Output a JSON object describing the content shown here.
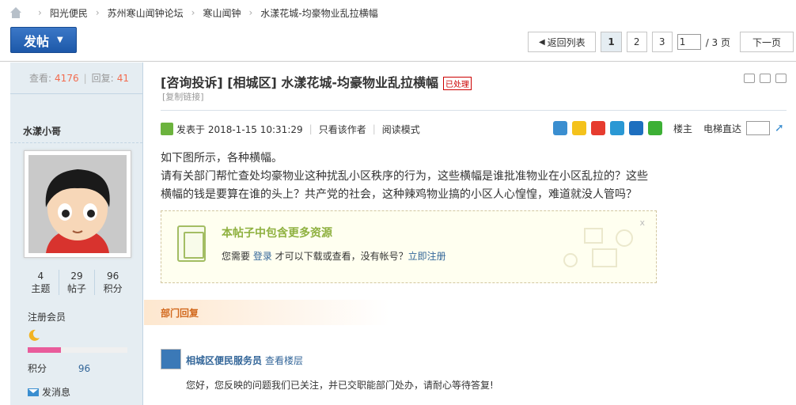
{
  "breadcrumb": {
    "home_icon": "home-icon",
    "items": [
      "阳光便民",
      "苏州寒山闻钟论坛",
      "寒山闻钟",
      "水漾花城-均豪物业乱拉横幅"
    ]
  },
  "toolbar": {
    "post_label": "发帖",
    "back_label": "返回列表",
    "pages": [
      "1",
      "2",
      "3"
    ],
    "current_page": "1",
    "page_input": "1",
    "total_pages": "/ 3 页",
    "next_label": "下一页"
  },
  "user": {
    "views_label": "查看:",
    "views": "4176",
    "replies_label": "回复:",
    "replies": "41",
    "name": "水漾小哥",
    "counts": [
      {
        "value": "4",
        "label": "主题"
      },
      {
        "value": "29",
        "label": "帖子"
      },
      {
        "value": "96",
        "label": "积分"
      }
    ],
    "rank": "注册会员",
    "level_progress": 0.33,
    "points_label": "积分",
    "points": "96",
    "send_message": "发消息"
  },
  "post": {
    "title": "[咨询投诉] [相城区] 水漾花城-均豪物业乱拉横幅",
    "stamp": "已处理",
    "copy_link": "[复制链接]",
    "posted_label": "发表于 2018-1-15 10:31:29",
    "only_author": "只看该作者",
    "read_mode": "阅读模式",
    "floor_label": "楼主",
    "elevator_label": "电梯直达",
    "body_line1": "如下图所示，各种横幅。",
    "body_line2": "请有关部门帮忙查处均豪物业这种扰乱小区秩序的行为，这些横幅是谁批准物业在小区乱拉的？这些横幅的钱是要算在谁的头上？共产党的社会，这种辣鸡物业搞的小区人心惶惶，难道就没人管吗？"
  },
  "attachment": {
    "heading": "本帖子中包含更多资源",
    "text_before": "您需要 ",
    "login": "登录",
    "text_mid": " 才可以下载或查看，没有帐号？",
    "register": "立即注册",
    "close": "x"
  },
  "department": {
    "label": "部门回复",
    "reply_name": "相城区便民服务员",
    "view_floor": "查看楼层",
    "reply_text": "您好，您反映的问题我们已关注，并已交职能部门处办，请耐心等待答复!"
  }
}
